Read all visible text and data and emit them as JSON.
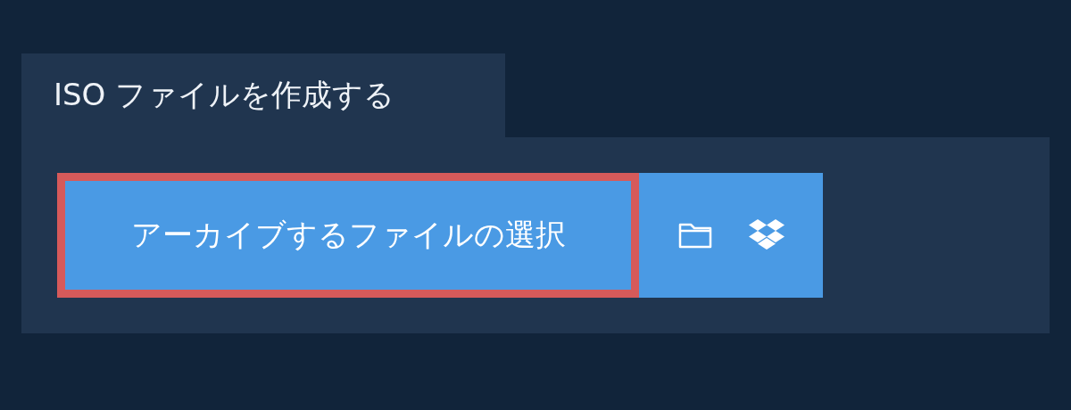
{
  "tab": {
    "label": "ISO ファイルを作成する"
  },
  "choose_button": {
    "label": "アーカイブするファイルの選択",
    "focused": true
  }
}
